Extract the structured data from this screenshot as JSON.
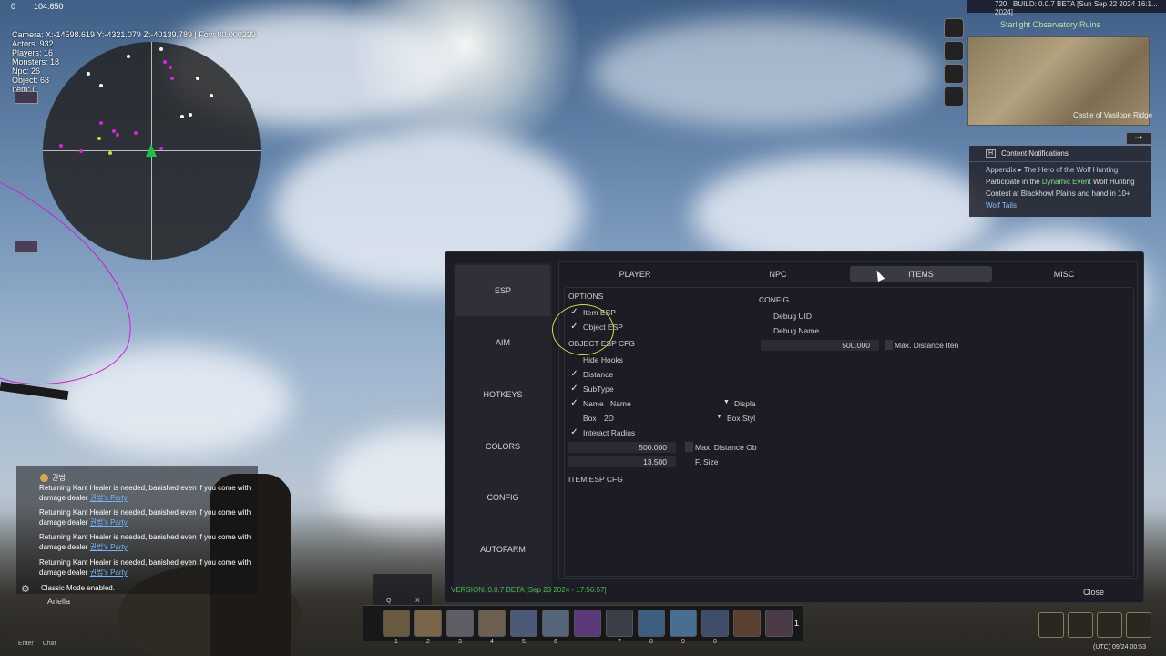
{
  "hud": {
    "top_value_1": "0",
    "top_value_2": "104.650",
    "camera": "Camera: X:-14598.619 Y:-4321.079 Z:-40139.789 | Fov: 80.000229",
    "actors": "Actors: 932",
    "players": "Players: 16",
    "monsters": "Monsters: 18",
    "npc": "Npc: 26",
    "object": "Object: 68",
    "item": "Item: 0"
  },
  "minimap": {
    "build": "BUILD: 0.0.7 BETA [Sun Sep 22 2024 16:1... 2024]",
    "top_num_1": "720",
    "top_num_2": "4500",
    "location": "Starlight Observatory Ruins",
    "bottom_label": "Castle of Vasilope Ridge"
  },
  "notifications": {
    "key": "H",
    "title": "Content Notifications",
    "appendix": "Appendix",
    "quest": "The Hero of the Wolf Hunting",
    "participate": "Participate in the",
    "event": "Dynamic Event",
    "body_rest_1": "Wolf",
    "body_rest_2": "Hunting Contest at Blackhowl Plains and",
    "body_rest_3": "hand in 10+",
    "wolf_tails": "Wolf Tails"
  },
  "panel": {
    "sidebar": [
      "ESP",
      "AIM",
      "HOTKEYS",
      "COLORS",
      "CONFIG",
      "AUTOFARM"
    ],
    "tabs": [
      "PLAYER",
      "NPC",
      "ITEMS",
      "MISC"
    ],
    "active_tab": "ITEMS",
    "options_header": "OPTIONS",
    "item_esp": "Item ESP",
    "object_esp": "Object ESP",
    "object_cfg_header": "OBJECT ESP CFG",
    "hide_hooks": "Hide Hooks",
    "distance": "Distance",
    "subtype": "SubType",
    "name_label": "Name",
    "name_value": "Name",
    "display_label": "Displa",
    "box_label": "Box",
    "box_value": "2D",
    "box_style_label": "Box Styl",
    "interact_radius": "Interact Radius",
    "max_distance_obj_value": "500.000",
    "max_distance_obj_label": "Max. Distance Ob",
    "font_size_value": "13.500",
    "font_size_label": "F. Size",
    "item_cfg_header": "ITEM ESP CFG",
    "config_header": "CONFIG",
    "debug_uid": "Debug UID",
    "debug_name": "Debug Name",
    "max_distance_item_value": "500.000",
    "max_distance_item_label": "Max. Distance Iten",
    "version": "VERSION: 0.0.7 BETA [Sep 23 2024 - 17:56:57]",
    "close": "Close"
  },
  "chat": {
    "channel": "권법",
    "messages": [
      {
        "text": "Returning Kant Healer is needed, banished even if you come with damage dealer",
        "party": "권법's Party"
      },
      {
        "text": "Returning Kant Healer is needed, banished even if you come with damage dealer",
        "party": "권법's Party"
      },
      {
        "text": "Returning Kant Healer is needed, banished even if you come with damage dealer",
        "party": "권법's Party"
      },
      {
        "text": "Returning Kant Healer is needed, banished even if you come with damage dealer",
        "party": "권법's Party"
      }
    ],
    "classic": "Classic Mode enabled.",
    "name": "Ariella",
    "enter": "Enter",
    "chat_label": "Chat"
  },
  "hotbar": {
    "slot_numbers": [
      "1",
      "2",
      "3",
      "4",
      "5",
      "6",
      "",
      "7",
      "8",
      "9",
      "0",
      "",
      ""
    ],
    "skill_keys": [
      "Q",
      "X"
    ],
    "counter": "1"
  },
  "bottom_right": {
    "utc": "(UTC) 09/24 00:53"
  }
}
